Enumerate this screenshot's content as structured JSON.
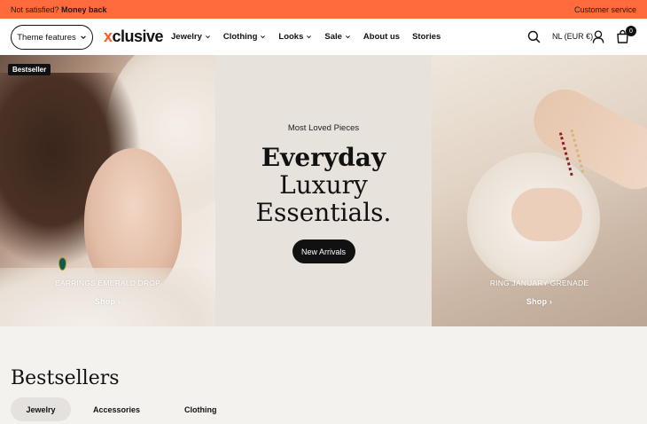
{
  "topbar": {
    "left_prefix": "Not satisfied?",
    "left_bold": "Money back",
    "right": "Customer service",
    "bg": "#ff6b3d"
  },
  "header": {
    "theme_button": "Theme features",
    "logo_mark": "x",
    "logo_text": "clusive",
    "nav": [
      {
        "label": "Jewelry",
        "has_dropdown": true
      },
      {
        "label": "Clothing",
        "has_dropdown": true
      },
      {
        "label": "Looks",
        "has_dropdown": true
      },
      {
        "label": "Sale",
        "has_dropdown": true
      },
      {
        "label": "About us",
        "has_dropdown": false
      },
      {
        "label": "Stories",
        "has_dropdown": false
      }
    ],
    "locale": "NL (EUR €)",
    "cart_count": "0",
    "icons": [
      "search-icon",
      "account-icon",
      "cart-icon"
    ]
  },
  "hero": {
    "left": {
      "badge": "Bestseller",
      "caption": "EARRINGS EMERALD DROP",
      "shop": "Shop"
    },
    "center": {
      "eyebrow": "Most Loved Pieces",
      "line1": "Everyday",
      "line2": "Luxury",
      "line3": "Essentials.",
      "cta": "New Arrivals"
    },
    "right": {
      "caption": "RING JANUARY GRENADE",
      "shop": "Shop"
    }
  },
  "bestsellers": {
    "title": "Bestsellers",
    "tabs": [
      "Jewelry",
      "Accessories",
      "Clothing"
    ],
    "active_tab": "Jewelry"
  }
}
